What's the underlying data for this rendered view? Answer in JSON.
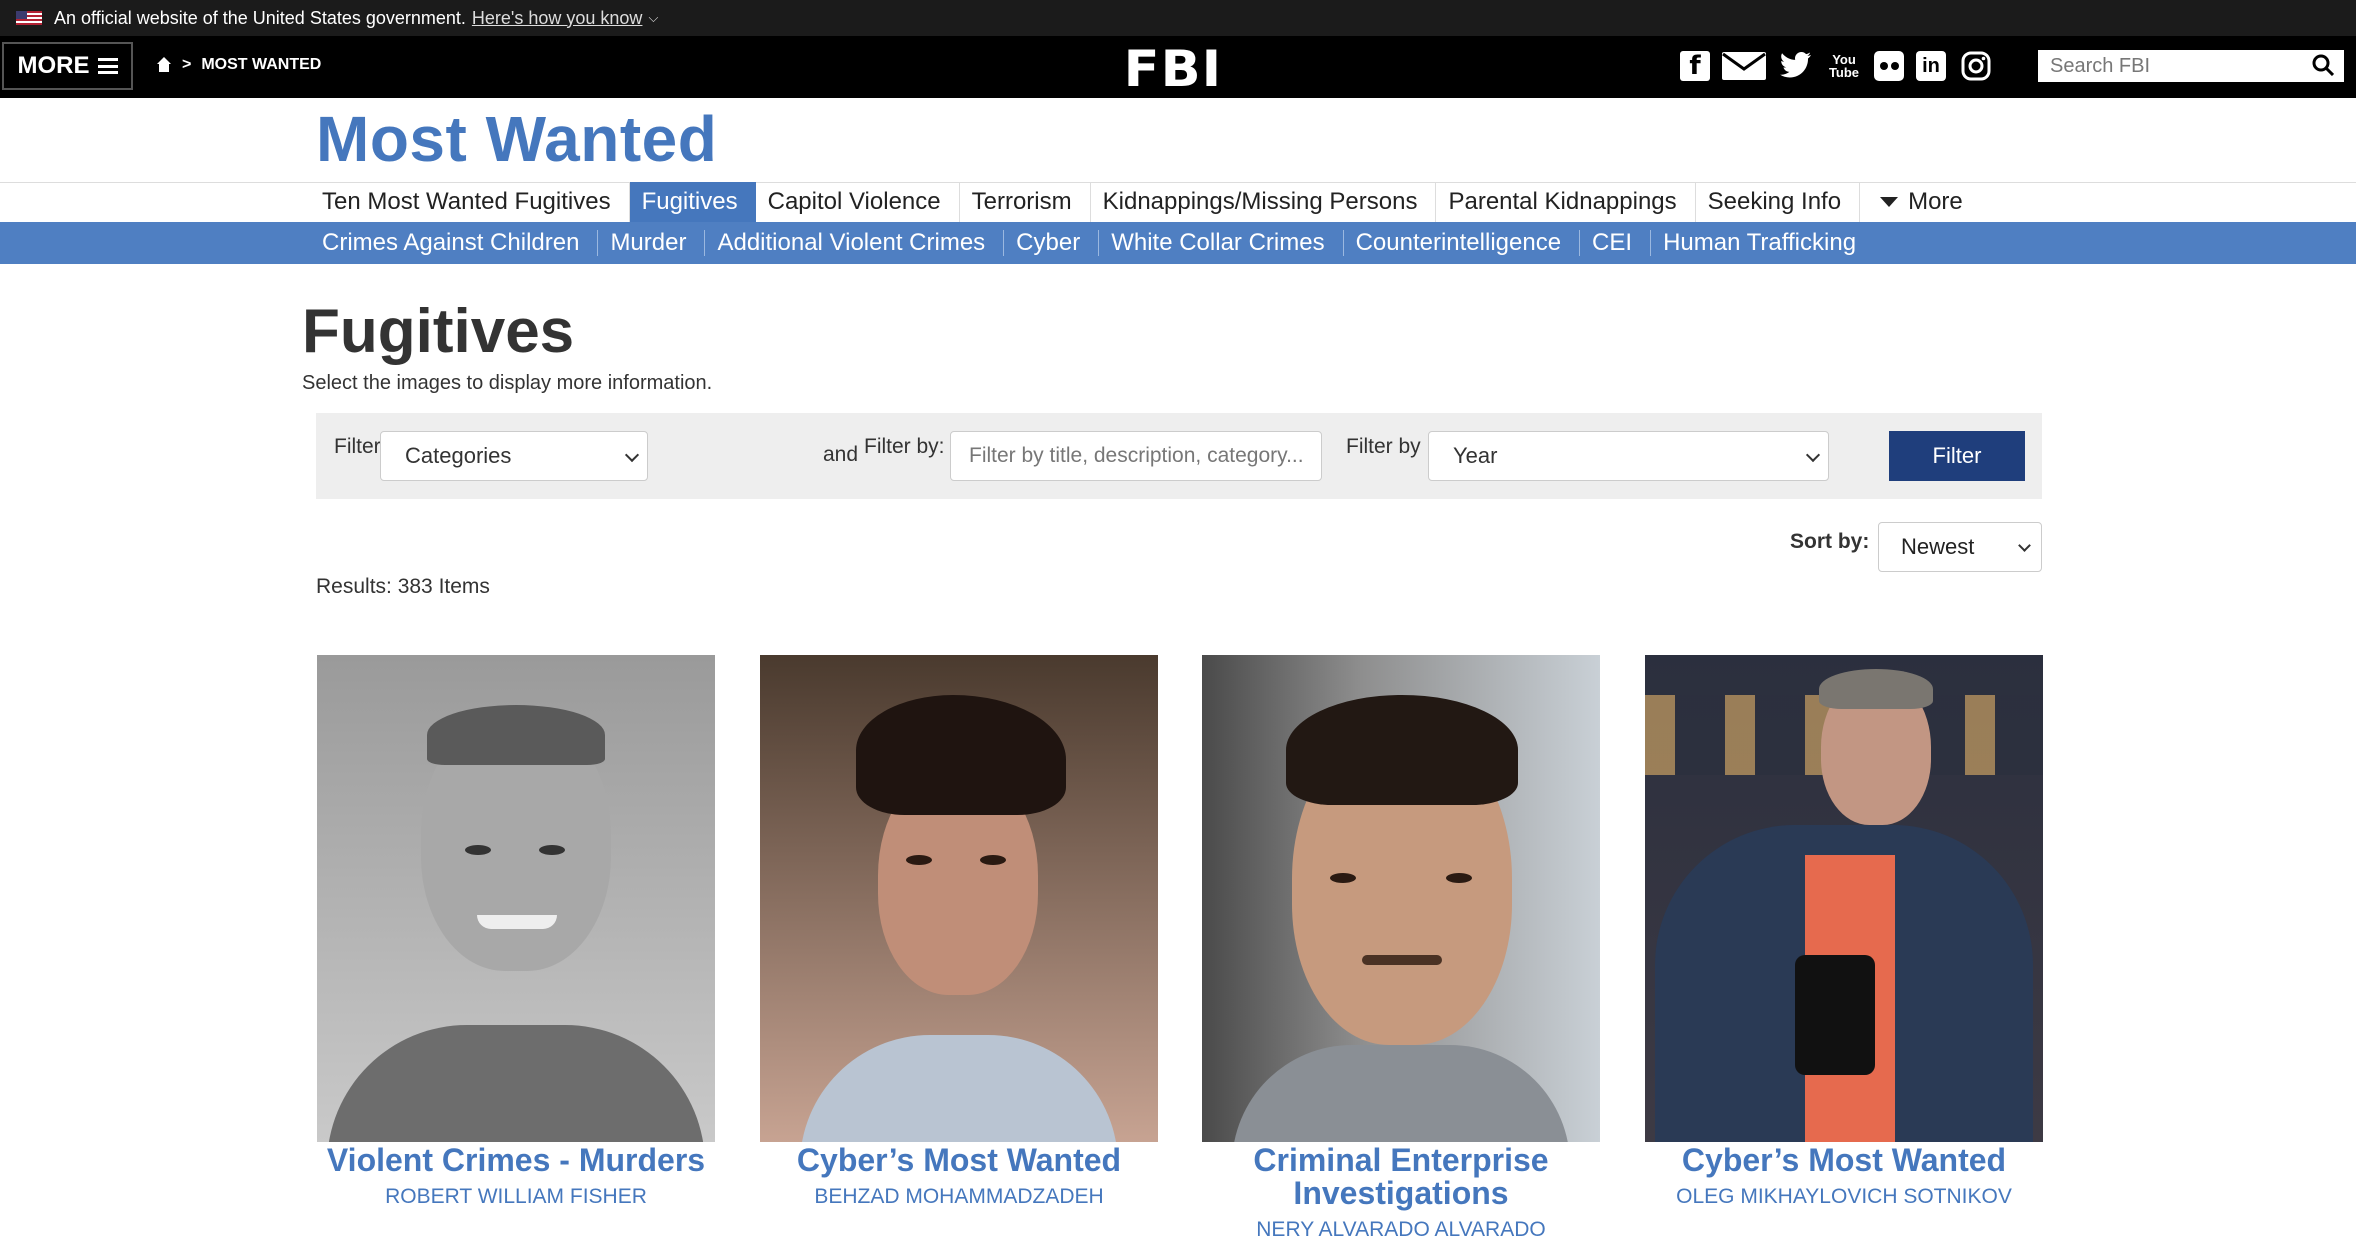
{
  "gov_banner": {
    "text": "An official website of the United States government.",
    "link": "Here's how you know"
  },
  "header": {
    "more_label": "MORE",
    "breadcrumb": "MOST WANTED",
    "logo": "FBI",
    "social_icons": [
      "facebook-icon",
      "email-icon",
      "twitter-icon",
      "youtube-icon",
      "flickr-icon",
      "linkedin-icon",
      "instagram-icon"
    ],
    "youtube_text_1": "You",
    "youtube_text_2": "Tube",
    "linkedin_text": "in",
    "facebook_text": "f",
    "search_placeholder": "Search FBI"
  },
  "site_title": "Most Wanted",
  "nav_primary": [
    "Ten Most Wanted Fugitives",
    "Fugitives",
    "Capitol Violence",
    "Terrorism",
    "Kidnappings/Missing Persons",
    "Parental Kidnappings",
    "Seeking Info",
    "More"
  ],
  "nav_secondary": [
    "Crimes Against Children",
    "Murder",
    "Additional Violent Crimes",
    "Cyber",
    "White Collar Crimes",
    "Counterintelligence",
    "CEI",
    "Human Trafficking"
  ],
  "page": {
    "heading": "Fugitives",
    "subheading": "Select the images to display more information."
  },
  "filters": {
    "label_1": "Filter by",
    "categories_value": "Categories",
    "label_and": "and",
    "label_2": "Filter by:",
    "text_placeholder": "Filter by title, description, category...",
    "label_3": "Filter by",
    "year_value": "Year",
    "button": "Filter"
  },
  "sort": {
    "label": "Sort by:",
    "value": "Newest"
  },
  "results_text": "Results: 383 Items",
  "cards": [
    {
      "title": "Violent Crimes - Murders",
      "name": "ROBERT WILLIAM FISHER"
    },
    {
      "title": "Cyber’s Most Wanted",
      "name": "BEHZAD MOHAMMADZADEH"
    },
    {
      "title": "Criminal Enterprise Investigations",
      "name": "NERY ALVARADO ALVARADO"
    },
    {
      "title": "Cyber’s Most Wanted",
      "name": "OLEG MIKHAYLOVICH SOTNIKOV"
    }
  ],
  "colors": {
    "brand_blue": "#4577bd",
    "nav2_bg": "#4f7fc2",
    "filter_button": "#1f3e7c",
    "header_bg": "#000000"
  }
}
